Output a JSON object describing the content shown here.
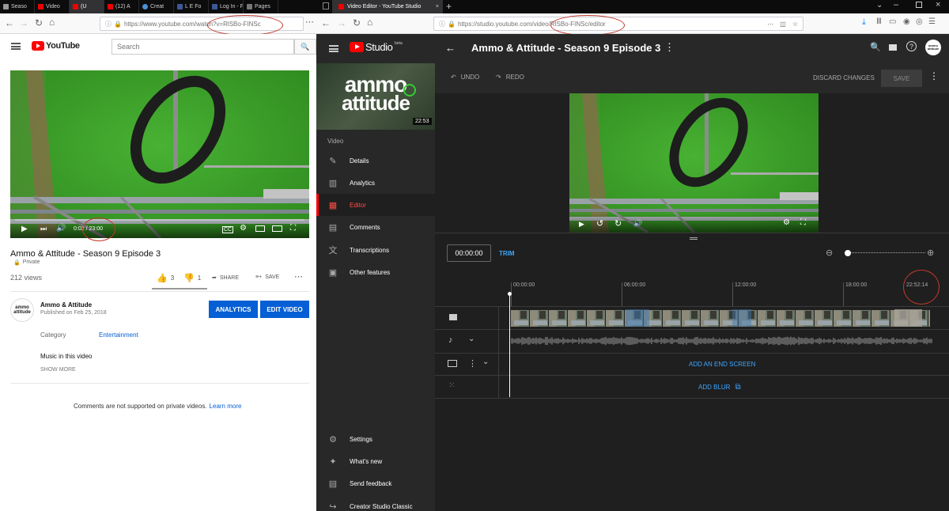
{
  "left_browser": {
    "tabs": [
      "Seaso",
      "Video",
      "(U",
      "(12) A",
      "Creat",
      "L E Fo",
      "Log In - F",
      "Pages"
    ],
    "url": "https://www.youtube.com/watch?v=RlSBo-FINSc",
    "search_placeholder": "Search",
    "logo_text": "YouTube",
    "player": {
      "time": "0:02 / 23:00"
    },
    "video_title": "Ammo & Attitude - Season 9 Episode 3",
    "privacy": "Private",
    "views": "212 views",
    "likes": "3",
    "dislikes": "1",
    "share_label": "SHARE",
    "save_label": "SAVE",
    "channel_name": "Ammo & Attitude",
    "published": "Published on Feb 25, 2018",
    "analytics_label": "ANALYTICS",
    "edit_label": "EDIT VIDEO",
    "category_label": "Category",
    "category_value": "Entertainment",
    "music_label": "Music in this video",
    "show_more": "SHOW MORE",
    "comments_note": "Comments are not supported on private videos.",
    "learn_more": "Learn more",
    "channel_avatar_text": "ammo attitude"
  },
  "right_browser": {
    "tab_title": "Video Editor - YouTube Studio",
    "url": "https://studio.youtube.com/video/RlSBo-FINSc/editor",
    "studio_logo": "Studio",
    "studio_beta": "beta",
    "page_title": "Ammo & Attitude - Season 9 Episode 3",
    "thumbnail_text_top": "ammo",
    "thumbnail_text_bottom": "attitude",
    "thumbnail_duration": "22:53",
    "video_label": "Video",
    "nav": [
      {
        "label": "Details",
        "icon": "pencil-icon"
      },
      {
        "label": "Analytics",
        "icon": "bar-chart-icon"
      },
      {
        "label": "Editor",
        "icon": "film-icon"
      },
      {
        "label": "Comments",
        "icon": "comment-icon"
      },
      {
        "label": "Transcriptions",
        "icon": "translate-icon"
      },
      {
        "label": "Other features",
        "icon": "other-features-icon"
      }
    ],
    "bottom_nav": [
      {
        "label": "Settings",
        "icon": "gear-icon"
      },
      {
        "label": "What's new",
        "icon": "sparkle-icon"
      },
      {
        "label": "Send feedback",
        "icon": "feedback-icon"
      },
      {
        "label": "Creator Studio Classic",
        "icon": "classic-icon"
      }
    ],
    "undo_label": "UNDO",
    "redo_label": "REDO",
    "discard_label": "DISCARD CHANGES",
    "save_label": "SAVE",
    "timecode": "00:00:00",
    "trim_label": "TRIM",
    "ruler": [
      "00:00:00",
      "06:00:00",
      "12:00:00",
      "18:00:00",
      "22:52:14"
    ],
    "end_screen_label": "ADD AN END SCREEN",
    "blur_label": "ADD BLUR",
    "zoom_level": 0.0
  },
  "colors": {
    "yt_red": "#ff0000",
    "blue_button": "#065fd4",
    "link_blue": "#3ea6ff",
    "annotation_red": "#c0392b",
    "green_screen": "#3fa42b"
  }
}
